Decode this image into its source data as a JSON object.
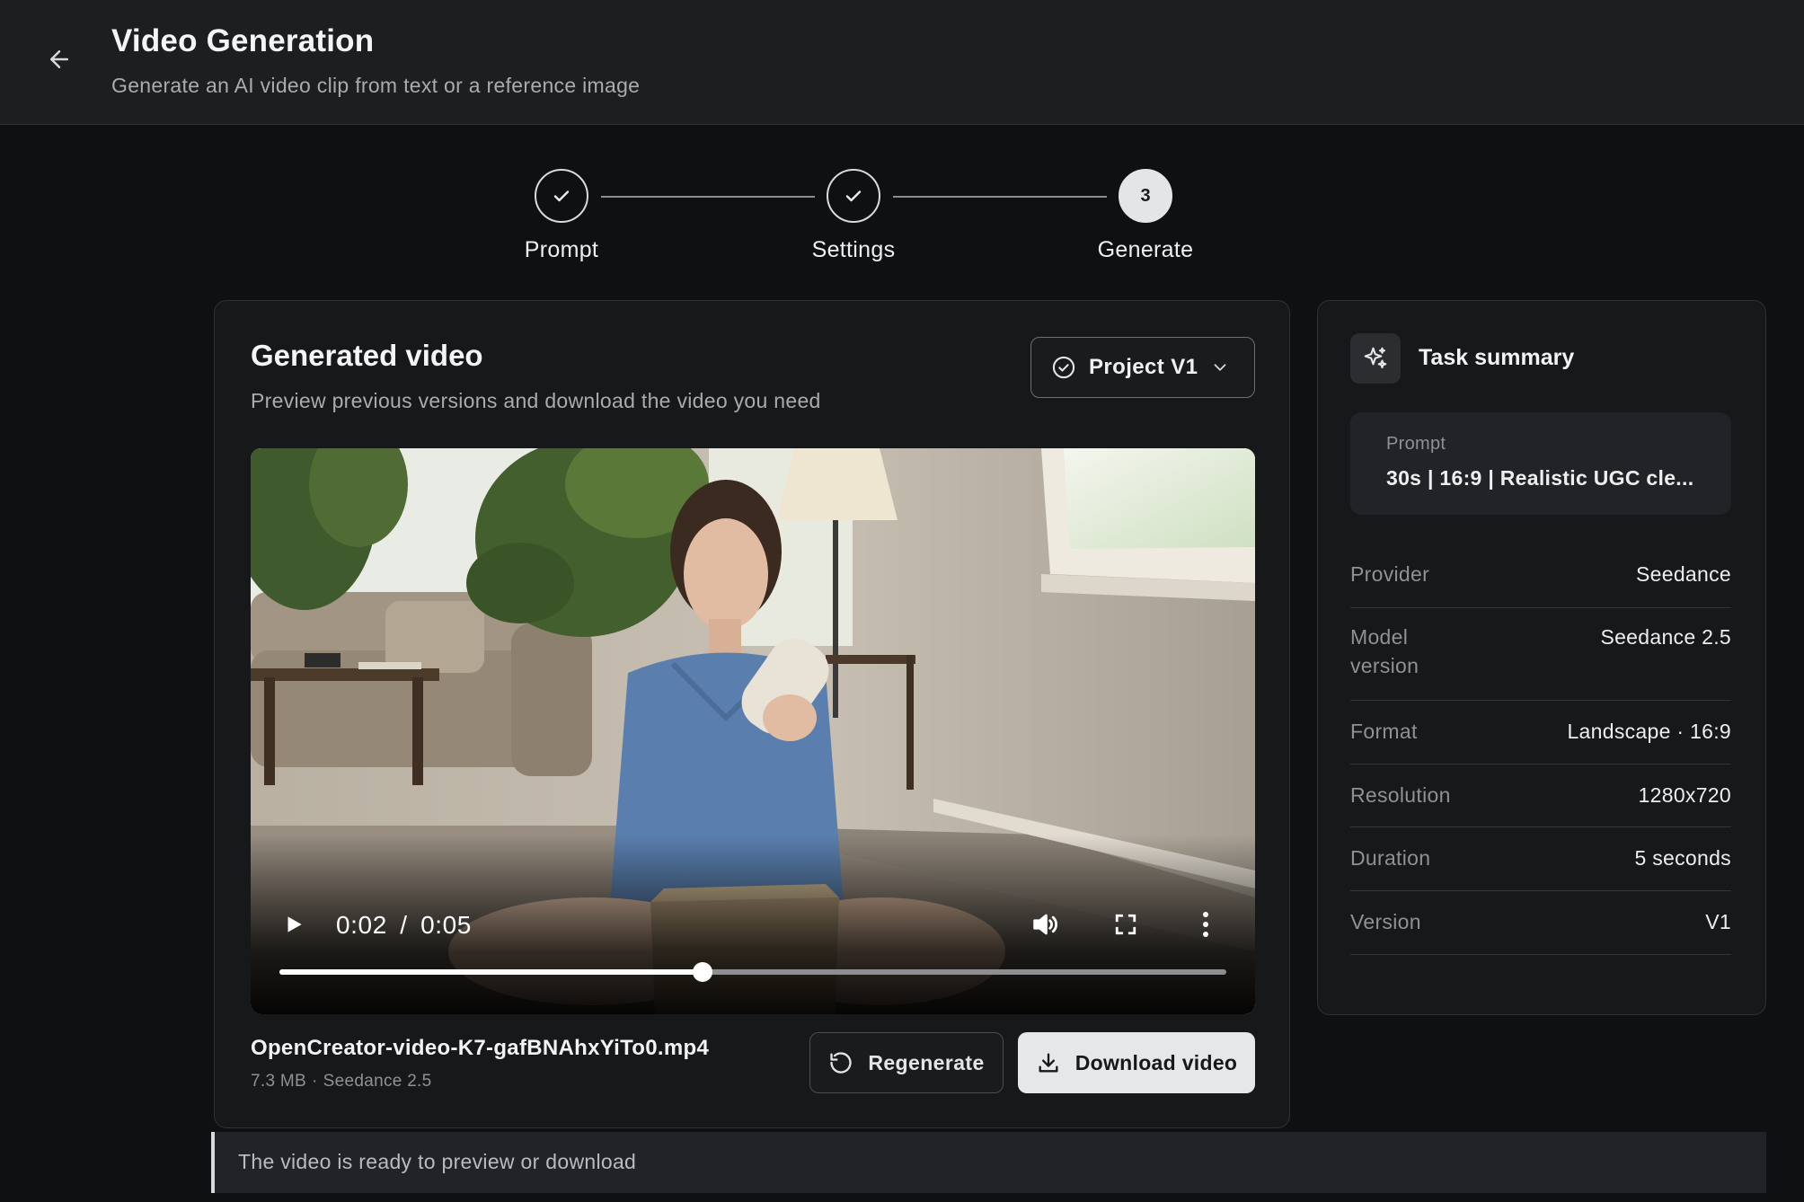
{
  "header": {
    "title": "Video Generation",
    "subtitle": "Generate an AI video clip from text or a reference image"
  },
  "stepper": {
    "steps": [
      {
        "label": "Prompt",
        "state": "done"
      },
      {
        "label": "Settings",
        "state": "done"
      },
      {
        "label": "Generate",
        "state": "active",
        "number": "3"
      }
    ]
  },
  "main": {
    "title": "Generated video",
    "subtitle": "Preview previous versions and download the video you need",
    "version_select": {
      "label": "Project V1"
    },
    "player": {
      "current_time": "0:02",
      "separator": "/",
      "duration": "0:05",
      "progress_fraction": 0.447
    },
    "file": {
      "name": "OpenCreator-video-K7-gafBNAhxYiTo0.mp4",
      "size": "7.3 MB",
      "meta_separator": "·",
      "model": "Seedance 2.5"
    },
    "buttons": {
      "regenerate": "Regenerate",
      "download": "Download video"
    }
  },
  "summary": {
    "title": "Task summary",
    "prompt_label": "Prompt",
    "prompt_value": "30s | 16:9 | Realistic UGC cle...",
    "rows": [
      {
        "label": "Provider",
        "value": "Seedance"
      },
      {
        "label": "Model version",
        "value": "Seedance 2.5"
      },
      {
        "label": "Format",
        "value": "Landscape · 16:9"
      },
      {
        "label": "Resolution",
        "value": "1280x720"
      },
      {
        "label": "Duration",
        "value": "5 seconds"
      },
      {
        "label": "Version",
        "value": "V1"
      }
    ]
  },
  "status": {
    "message": "The video is ready to preview or download"
  },
  "icons": {
    "back": "arrow-left-icon",
    "step_done": "check-icon",
    "version": "check-circle-icon",
    "dropdown": "chevron-down-icon",
    "play": "play-icon",
    "volume": "volume-icon",
    "fullscreen": "fullscreen-icon",
    "more": "more-vertical-icon",
    "regenerate": "rotate-ccw-icon",
    "download": "download-icon",
    "summary": "sparkles-icon"
  }
}
